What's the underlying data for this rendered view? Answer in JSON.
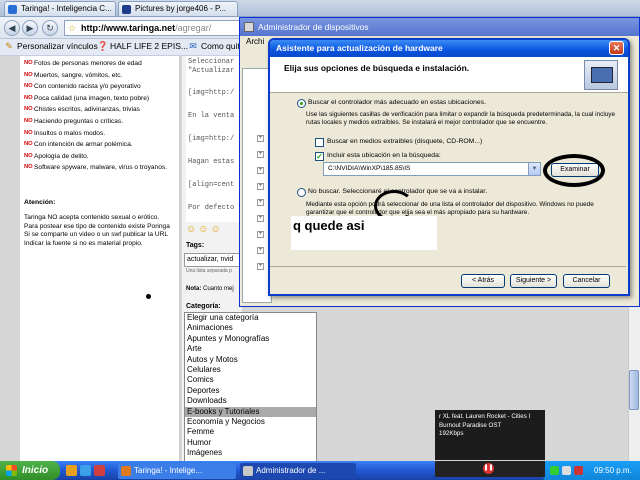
{
  "browser": {
    "tabs": [
      {
        "label": "Taringa! - Inteligencia C..."
      },
      {
        "label": "Pictures by jorge406 - P..."
      }
    ],
    "url": {
      "domain": "http://www.taringa.net",
      "path": "/agregar/"
    },
    "bookmarks": [
      "Personalizar vínculos",
      "HALF LIFE 2 EPIS...",
      "Como quit"
    ]
  },
  "rules": [
    "Fotos de personas menores de edad",
    "Muertos, sangre, vómitos, etc.",
    "Con contenido racista y/o peyorativo",
    "Poca calidad (una imagen, texto pobre)",
    "Chistes escritos, adivinanzas, trivias",
    "Haciendo preguntas o críticas.",
    "Insultos o malos modos.",
    "Con intención de armar polémica.",
    "Apología de delito.",
    "Software spyware, malware, virus o troyanos."
  ],
  "atencion": {
    "title": "Atención:",
    "lines": [
      "Taringa NO acepta contenido sexual o erótico.",
      "Para postear ese tipo de contenido existe Poringa",
      "Si se comparte un video o un swf publicar la URL",
      "Indicar la fuente si no es material propio."
    ]
  },
  "editor": {
    "lines": [
      "Seleccionar",
      "\"Actualizar",
      "[img=http:/",
      "En la venta",
      "[img=http:/",
      "Hagan estas",
      "[align=cent",
      "Por defecto"
    ]
  },
  "tags": {
    "label": "Tags:",
    "value": "actualizar, nvid",
    "hint": "Una lista separada p"
  },
  "nota": {
    "bold": "Nota:",
    "text": "Cuanto mej"
  },
  "categoria": {
    "label": "Categoría:",
    "items": [
      "Elegir una categoría",
      "Animaciones",
      "Apuntes y Monografías",
      "Arte",
      "Autos y Motos",
      "Celulares",
      "Comics",
      "Deportes",
      "Downloads",
      "E-books y Tutoriales",
      "Economía y Negocios",
      "Femme",
      "Humor",
      "Imágenes"
    ],
    "selected": "E-books y Tutoriales"
  },
  "devmgr": {
    "title": "Administrador de dispositivos",
    "menu": "Archi"
  },
  "wizard": {
    "title": "Asistente para actualización de hardware",
    "header": "Elija sus opciones de búsqueda e instalación.",
    "option_search": "Buscar el controlador más adecuado en estas ubicaciones.",
    "option_search_desc": "Use las siguientes casillas de verificación para limitar o expandir la búsqueda predeterminada, la cual incluye rutas locales y medios extraíbles. Se instalará el mejor controlador que se encuentre.",
    "check_removable": "Buscar en medios extraíbles (disquete, CD-ROM...)",
    "check_include": "Incluir esta ubicación en la búsqueda:",
    "path": "C:\\NVIDIA\\WinXP\\185.85\\IS",
    "browse": "Examinar",
    "option_nosearch": "No buscar. Seleccionaré el controlador que se va a instalar.",
    "option_nosearch_desc": "Mediante esta opción podrá seleccionar de una lista el controlador del dispositivo. Windows no puede garantizar que el controlador que elija sea el más apropiado para su hardware.",
    "back": "< Atrás",
    "next": "Siguiente >",
    "cancel": "Cancelar"
  },
  "annotation": "q quede asi",
  "player": {
    "lines": [
      "r XL feat. Lauren Rocket - Cities I",
      "Burnout Paradise OST",
      "192Kbps"
    ]
  },
  "taskbar": {
    "start": "Inicio",
    "buttons": [
      "Taringa! - Intelige...",
      "Administrador de ..."
    ],
    "clock": "09:50 p.m."
  },
  "colors": {
    "taskbar": "#245edb",
    "start": "#2f8e28",
    "wizard_title": "#0a55e0",
    "rule_no": "#dd0000"
  }
}
